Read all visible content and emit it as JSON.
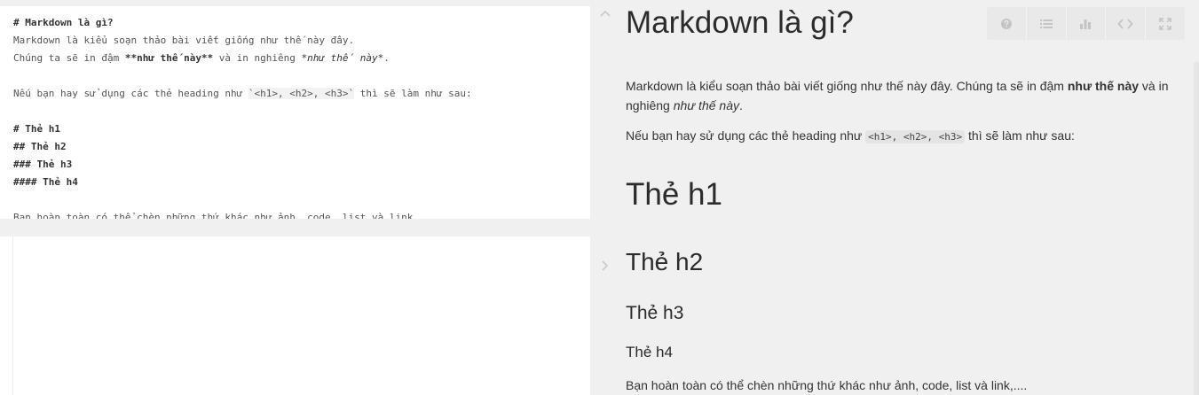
{
  "editor": {
    "lines": [
      "# Markdown là gì?",
      "Markdown là kiểu soạn thảo bài viết giống như thế này đây.",
      "Chúng ta sẽ in đậm **như thế này** và in nghiêng *như thế này*.",
      "",
      "Nếu bạn hay sử dụng các thẻ heading như `<h1>, <h2>, <h3>` thì sẽ làm như sau:",
      "",
      "# Thẻ h1",
      "## Thẻ h2",
      "### Thẻ h3",
      "#### Thẻ h4",
      "",
      "Bạn hoàn toàn có thể chèn những thứ khác như ảnh, code, list và link,...."
    ],
    "line3_parts": {
      "before": "Chúng ta sẽ in đậm ",
      "bold": "**như thế này**",
      "middle": " và in nghiêng ",
      "italic": "*như thế này*",
      "after": "."
    },
    "line5_parts": {
      "before": "Nếu bạn hay sử dụng các thẻ heading như ",
      "code": "`<h1>, <h2>, <h3>`",
      "after": " thì sẽ làm như sau:"
    }
  },
  "preview": {
    "title": "Markdown là gì?",
    "p1": {
      "before": "Markdown là kiểu soạn thảo bài viết giống như thế này đây. Chúng ta sẽ in đậm ",
      "bold": "như thế này",
      "middle": " và in nghiêng ",
      "italic": "như thế này",
      "after": "."
    },
    "p2": {
      "before": "Nếu bạn hay sử dụng các thẻ heading như ",
      "code": "<h1>, <h2>, <h3>",
      "after": " thì sẽ làm như sau:"
    },
    "h1": "Thẻ h1",
    "h2": "Thẻ h2",
    "h3": "Thẻ h3",
    "h4": "Thẻ h4",
    "p3": "Bạn hoàn toàn có thể chèn những thứ khác như ảnh, code, list và link,...."
  },
  "toolbar": {
    "buttons": [
      {
        "icon": "help-icon"
      },
      {
        "icon": "list-icon"
      },
      {
        "icon": "bar-chart-icon"
      },
      {
        "icon": "code-icon"
      },
      {
        "icon": "fullscreen-icon"
      }
    ]
  },
  "colors": {
    "background": "#f0f0f0",
    "editor_bg": "#ffffff",
    "text": "#333333",
    "icon": "#c4c4c4",
    "toolbar_bg": "#e9e9e9"
  }
}
